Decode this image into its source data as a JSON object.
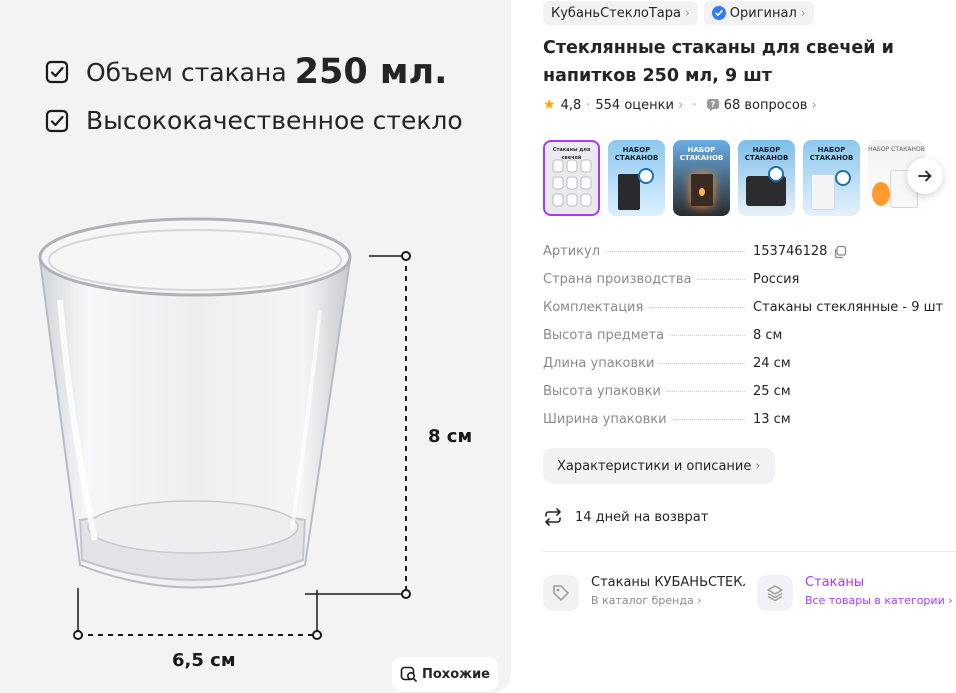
{
  "hero": {
    "feature1_prefix": "Объем стакана",
    "feature1_bold": "250 мл.",
    "feature2": "Высококачественное стекло",
    "height_label": "8 см",
    "width_label": "6,5 см",
    "similar_label": "Похожие"
  },
  "brand_chip": "КубаньСтеклоТара",
  "original_chip": "Оригинал",
  "title": "Стеклянные стаканы для свечей и напитков 250 мл, 9 шт",
  "rating": {
    "score": "4,8",
    "reviews": "554 оценки",
    "questions": "68 вопросов"
  },
  "thumbnails": [
    {
      "caption": "Стаканы для свечей",
      "bg": "#e9e9ef"
    },
    {
      "caption": "НАБОР СТАКАНОВ",
      "bg": "#6fb6e8"
    },
    {
      "caption": "НАБОР СТАКАНОВ",
      "bg": "#5a9fd8"
    },
    {
      "caption": "НАБОР СТАКАНОВ",
      "bg": "#6aaee0"
    },
    {
      "caption": "НАБОР СТАКАНОВ",
      "bg": "#74b8e6"
    },
    {
      "caption": "НАБОР СТАКАНОВ",
      "bg": "#e9e9ec"
    }
  ],
  "specs": [
    {
      "key": "Артикул",
      "value": "153746128"
    },
    {
      "key": "Страна производства",
      "value": "Россия"
    },
    {
      "key": "Комплектация",
      "value": "Стаканы стеклянные - 9 шт"
    },
    {
      "key": "Высота предмета",
      "value": "8 см"
    },
    {
      "key": "Длина упаковки",
      "value": "24 см"
    },
    {
      "key": "Высота упаковки",
      "value": "25 см"
    },
    {
      "key": "Ширина упаковки",
      "value": "13 см"
    }
  ],
  "char_button": "Характеристики и описание",
  "returns": "14 дней на возврат",
  "brand_block": {
    "title": "Стаканы КУБАНЬСТЕКЛОТАРА",
    "sub": "В каталог бренда"
  },
  "category_block": {
    "title": "Стаканы",
    "sub": "Все товары в категории"
  },
  "colors": {
    "accent": "#a73afd",
    "star": "#ffa500",
    "verified": "#2f7cf6"
  }
}
